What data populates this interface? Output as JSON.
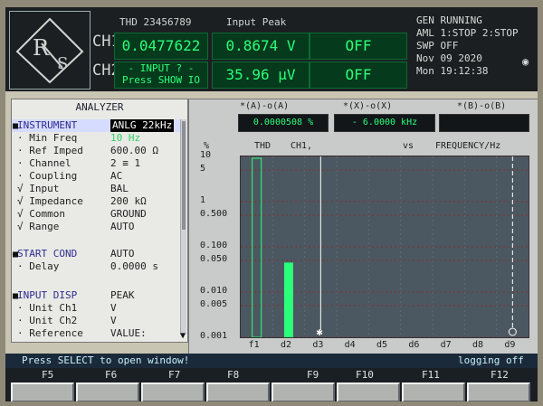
{
  "header": {
    "ch1": "CH1",
    "ch2": "CH2",
    "thd_title": "THD 23456789",
    "input_peak_title": "Input Peak",
    "ch1_thd": "0.0477622 %",
    "ch2_thd": "- INPUT ? -",
    "ch2_thd_sub": "Press SHOW IO",
    "ch1_input": "0.8674  V",
    "ch2_input": "35.96 µV",
    "off1": "OFF",
    "off2": "OFF",
    "status_lines": [
      "GEN RUNNING",
      "AML 1:STOP 2:STOP",
      "SWP OFF",
      "Nov 09 2020",
      "Mon 19:12:38"
    ]
  },
  "analyzer": {
    "title": "ANALYZER",
    "rows": [
      {
        "label": "INSTRUMENT",
        "value": "ANLG 22kHz",
        "highlight": true
      },
      {
        "label": "· Min Freq",
        "value": "10 Hz",
        "highlight": false,
        "value_green": true
      },
      {
        "label": "· Ref Imped",
        "value": "600.00 Ω"
      },
      {
        "label": "· Channel",
        "value": "2 ≡ 1"
      },
      {
        "label": "· Coupling",
        "value": "AC"
      },
      {
        "label": "√ Input",
        "value": "BAL"
      },
      {
        "label": "√ Impedance",
        "value": "200 kΩ"
      },
      {
        "label": "√ Common",
        "value": "GROUND"
      },
      {
        "label": "√ Range",
        "value": "AUTO"
      },
      {
        "label": "",
        "value": ""
      },
      {
        "label": "START COND",
        "value": "AUTO",
        "blue": true
      },
      {
        "label": "· Delay",
        "value": "0.0000 s"
      },
      {
        "label": "",
        "value": ""
      },
      {
        "label": "INPUT DISP",
        "value": "PEAK",
        "blue": true
      },
      {
        "label": "· Unit Ch1",
        "value": "V"
      },
      {
        "label": "· Unit Ch2",
        "value": "V"
      },
      {
        "label": "· Reference",
        "value": "VALUE:"
      }
    ]
  },
  "graph": {
    "hdr1_label": "*(A)-o(A)",
    "hdr1_value": "0.0000508 %",
    "hdr2_label": "*(X)-o(X)",
    "hdr2_value": "- 6.0000 kHz",
    "hdr3_label": "*(B)-o(B)",
    "hdr3_value": "",
    "unit_label": "%",
    "thd_label": "THD",
    "ch1_label": "CH1,",
    "vs_label": "vs",
    "freq_label": "FREQUENCY/Hz",
    "y_ticks": [
      "10",
      "5",
      "1",
      "0.500",
      "0.100",
      "0.050",
      "0.010",
      "0.005",
      "0.001"
    ],
    "x_ticks": [
      "f1",
      "d2",
      "d3",
      "d4",
      "d5",
      "d6",
      "d7",
      "d8",
      "d9"
    ]
  },
  "chart_data": {
    "type": "bar",
    "categories": [
      "f1",
      "d2",
      "d3",
      "d4",
      "d5",
      "d6",
      "d7",
      "d8",
      "d9"
    ],
    "values": [
      0,
      0.045,
      0,
      0,
      0,
      0,
      0,
      0,
      0
    ],
    "ylim": [
      0.001,
      10
    ],
    "y_scale": "log"
  },
  "footer": {
    "status_left": "Press SELECT to open window!",
    "status_right": "logging off",
    "fkeys": [
      "F5",
      "F6",
      "F7",
      "F8",
      "F9",
      "F10",
      "F11",
      "F12"
    ]
  },
  "colors": {
    "green": "#2bff7a",
    "dark": "#1b1f22",
    "panel": "#e9eae6"
  }
}
